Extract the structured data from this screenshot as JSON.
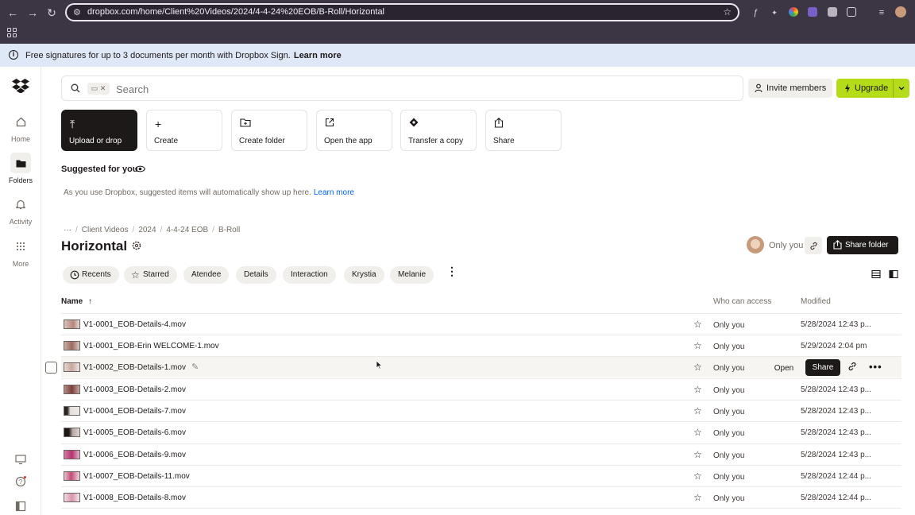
{
  "browser": {
    "url": "dropbox.com/home/Client%20Videos/2024/4-4-24%20EOB/B-Roll/Horizontal"
  },
  "banner": {
    "text": "Free signatures for up to 3 documents per month with Dropbox Sign.",
    "link": "Learn more"
  },
  "rail": {
    "home": "Home",
    "folders": "Folders",
    "activity": "Activity",
    "more": "More"
  },
  "search": {
    "placeholder": "Search"
  },
  "header": {
    "invite": "Invite members",
    "upgrade": "Upgrade"
  },
  "actions": [
    {
      "label": "Upload or drop",
      "icon": "upload-icon"
    },
    {
      "label": "Create",
      "icon": "plus-icon"
    },
    {
      "label": "Create folder",
      "icon": "folder-plus-icon"
    },
    {
      "label": "Open the app",
      "icon": "open-external-icon"
    },
    {
      "label": "Transfer a copy",
      "icon": "transfer-icon"
    },
    {
      "label": "Share",
      "icon": "share-icon"
    }
  ],
  "suggested": {
    "heading": "Suggested for you",
    "text": "As you use Dropbox, suggested items will automatically show up here.",
    "link": "Learn more"
  },
  "breadcrumb": [
    "Client Videos",
    "2024",
    "4-4-24 EOB",
    "B-Roll"
  ],
  "breadcrumb_more": "···",
  "folder": {
    "title": "Horizontal",
    "access": "Only you",
    "share_button": "Share folder"
  },
  "filters": [
    "Recents",
    "Starred",
    "Atendee",
    "Details",
    "Interaction",
    "Krystia",
    "Melanie"
  ],
  "table": {
    "col_name": "Name",
    "col_access": "Who can access",
    "col_modified": "Modified",
    "rows": [
      {
        "name": "V1-0001_EOB-Details-4.mov",
        "access": "Only you",
        "modified": "5/28/2024 12:43 p..."
      },
      {
        "name": "V1-0001_EOB-Erin WELCOME-1.mov",
        "access": "Only you",
        "modified": "5/29/2024 2:04 pm"
      },
      {
        "name": "V1-0002_EOB-Details-1.mov",
        "access": "Only you",
        "modified": ""
      },
      {
        "name": "V1-0003_EOB-Details-2.mov",
        "access": "Only you",
        "modified": "5/28/2024 12:43 p..."
      },
      {
        "name": "V1-0004_EOB-Details-7.mov",
        "access": "Only you",
        "modified": "5/28/2024 12:43 p..."
      },
      {
        "name": "V1-0005_EOB-Details-6.mov",
        "access": "Only you",
        "modified": "5/28/2024 12:43 p..."
      },
      {
        "name": "V1-0006_EOB-Details-9.mov",
        "access": "Only you",
        "modified": "5/28/2024 12:43 p..."
      },
      {
        "name": "V1-0007_EOB-Details-11.mov",
        "access": "Only you",
        "modified": "5/28/2024 12:44 p..."
      },
      {
        "name": "V1-0008_EOB-Details-8.mov",
        "access": "Only you",
        "modified": "5/28/2024 12:44 p..."
      }
    ],
    "hover_open": "Open",
    "hover_share": "Share"
  },
  "colors": {
    "accent": "#b4dc19",
    "dark": "#1e1919",
    "link": "#0061fe",
    "banner": "#dfe8f6"
  }
}
